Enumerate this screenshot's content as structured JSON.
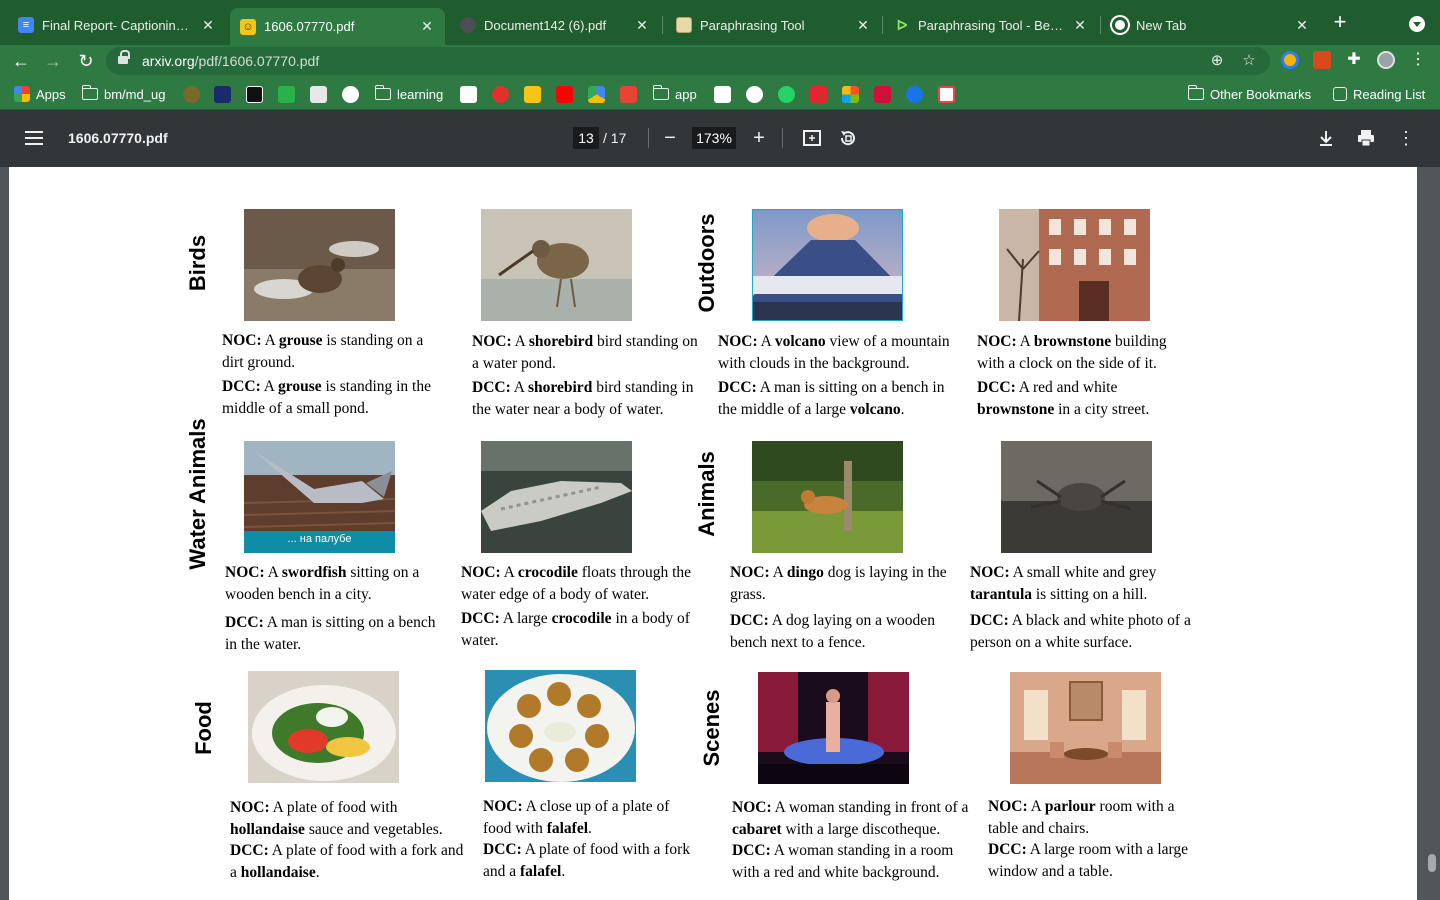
{
  "tabs": [
    {
      "title": "Final Report- Captioning im",
      "active": false
    },
    {
      "title": "1606.07770.pdf",
      "active": true
    },
    {
      "title": "Document142 (6).pdf",
      "active": false
    },
    {
      "title": "Paraphrasing Tool",
      "active": false
    },
    {
      "title": "Paraphrasing Tool - Best Sc",
      "active": false
    },
    {
      "title": "New Tab",
      "active": false
    }
  ],
  "address": {
    "host": "arxiv.org",
    "path": "/pdf/1606.07770.pdf"
  },
  "bookmarks": {
    "apps": "Apps",
    "bm_md_ug": "bm/md_ug",
    "learning": "learning",
    "app": "app",
    "other": "Other Bookmarks",
    "reading_list": "Reading List"
  },
  "pdf": {
    "filename": "1606.07770.pdf",
    "page_current": "13",
    "page_total": "/ 17",
    "zoom": "173%"
  },
  "figure": {
    "categories": {
      "birds": "Birds",
      "outdoors": "Outdoors",
      "water_animals": "Water Animals",
      "animals": "Animals",
      "food": "Food",
      "scenes": "Scenes"
    },
    "photo_overlay_text": "... на палубе",
    "labels": {
      "noc": "NOC:",
      "dcc": "DCC:"
    },
    "items": [
      {
        "noc": [
          "A ",
          "grouse",
          " is standing on a dirt ground."
        ],
        "dcc": [
          "A ",
          "grouse",
          " is standing in the middle of a small pond."
        ]
      },
      {
        "noc": [
          "A ",
          "shorebird",
          " bird standing on a water pond."
        ],
        "dcc": [
          "A ",
          "shorebird",
          " bird standing in the water near a body of water."
        ]
      },
      {
        "noc": [
          "A ",
          "volcano",
          " view of a mountain with clouds in the background."
        ],
        "dcc": [
          "A man is sitting on a bench in the middle of a large ",
          "volcano",
          "."
        ]
      },
      {
        "noc": [
          "A ",
          "brownstone",
          " building with a clock on the side of it."
        ],
        "dcc": [
          "A red and white ",
          "brownstone",
          " in a city street."
        ]
      },
      {
        "noc": [
          "A ",
          "swordfish",
          " sitting on a wooden bench in a city."
        ],
        "dcc": [
          "A man is sitting on a bench in the water.",
          "",
          ""
        ]
      },
      {
        "noc": [
          "A ",
          "crocodile",
          " floats through the water edge of a body of water."
        ],
        "dcc": [
          "A large ",
          "crocodile",
          " in a body of water."
        ]
      },
      {
        "noc": [
          "A ",
          "dingo",
          " dog is laying in the grass."
        ],
        "dcc": [
          "A dog laying on a wooden bench next to a fence.",
          "",
          ""
        ]
      },
      {
        "noc": [
          "A small white and grey ",
          "tarantula",
          " is sitting on a hill."
        ],
        "dcc": [
          "A black and white photo of a person on a white surface.",
          "",
          ""
        ]
      },
      {
        "noc": [
          "A plate of food with ",
          "hollandaise",
          " sauce and vegetables."
        ],
        "dcc": [
          "A plate of food with a fork and a ",
          "hollandaise",
          "."
        ]
      },
      {
        "noc": [
          "A close up of a plate of food with ",
          "falafel",
          "."
        ],
        "dcc": [
          "A plate of food with a fork and a ",
          "falafel",
          "."
        ]
      },
      {
        "noc": [
          "A woman standing in front of a ",
          "cabaret",
          " with a large discotheque."
        ],
        "dcc": [
          "A woman standing in a room with a red and white background.",
          "",
          ""
        ]
      },
      {
        "noc": [
          "A ",
          "parlour",
          " room with a table and chairs."
        ],
        "dcc": [
          "A large room with a large window and a table.",
          "",
          ""
        ]
      }
    ]
  },
  "colors": {
    "tabstrip": "#1f5c2e",
    "toolbar": "#2f7a42",
    "pdf_toolbar": "#323639",
    "viewer_bg": "#525659"
  }
}
